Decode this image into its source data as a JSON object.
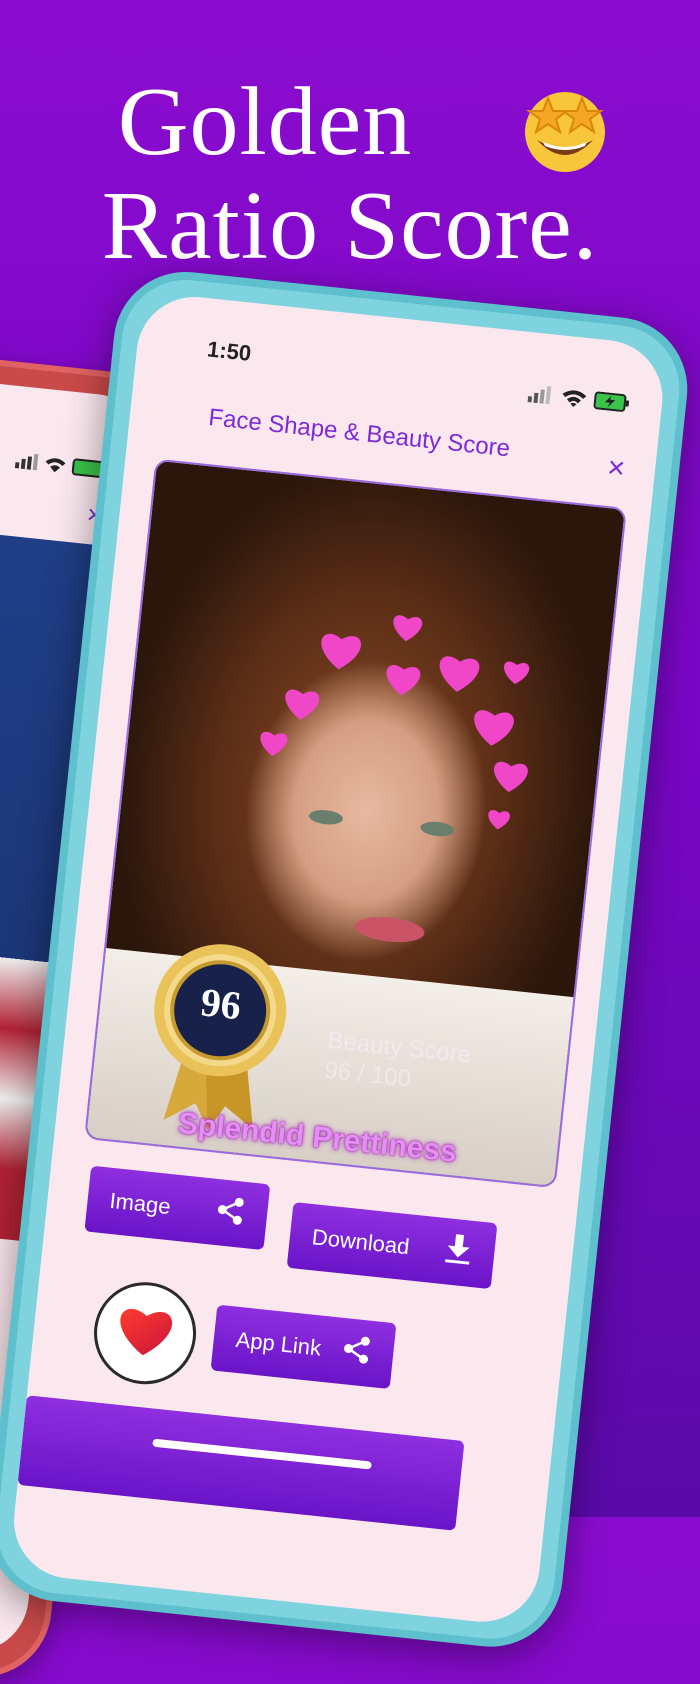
{
  "headline": {
    "line1": "Golden",
    "line2": "Ratio Score."
  },
  "emoji": {
    "icon": "star-struck-emoji"
  },
  "front": {
    "time": "1:50",
    "title": "Face Shape & Beauty Score",
    "close_label": "×",
    "badge_number": "96",
    "score_label": "Beauty Score",
    "score_value": "96 / 100",
    "rating": "Splendid Prettiness",
    "buttons": {
      "image": "Image",
      "download": "Download",
      "app_link": "App Link"
    }
  },
  "back": {
    "close_label": "×"
  },
  "colors": {
    "background": "#7a06c6",
    "accent": "#7c2ad6",
    "front_frame": "#7fd3df",
    "back_frame": "#c94a4a"
  }
}
